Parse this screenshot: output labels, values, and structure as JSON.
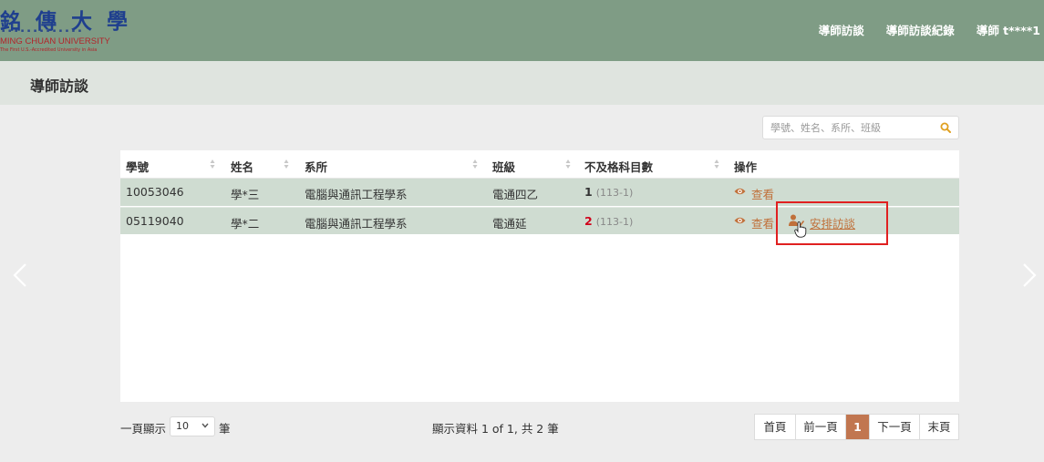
{
  "header": {
    "logo": {
      "name_cn": "銘 傳 大 學",
      "name_en": "MING CHUAN UNIVERSITY",
      "tagline": "The First U.S.-Accredited University in Asia"
    },
    "nav": [
      "導師訪談",
      "導師訪談紀錄",
      "導師 t****1"
    ]
  },
  "page_title": "導師訪談",
  "search": {
    "placeholder": "學號、姓名、系所、班級",
    "value": ""
  },
  "table": {
    "columns": [
      "學號",
      "姓名",
      "系所",
      "班級",
      "不及格科目數",
      "操作"
    ],
    "rows": [
      {
        "student_id": "10053046",
        "name": "學*三",
        "department": "電腦與通訊工程學系",
        "class": "電通四乙",
        "fail_count": "1",
        "term": "(113-1)",
        "actions": [
          "查看"
        ]
      },
      {
        "student_id": "05119040",
        "name": "學*二",
        "department": "電腦與通訊工程學系",
        "class": "電通延",
        "fail_count": "2",
        "term": "(113-1)",
        "actions": [
          "查看",
          "安排訪談"
        ]
      }
    ]
  },
  "footer": {
    "page_size_label": "一頁顯示",
    "page_size_value": "10",
    "page_size_unit": "筆",
    "info": "顯示資料 1 of 1, 共 2 筆",
    "pager": [
      "首頁",
      "前一頁",
      "1",
      "下一頁",
      "末頁"
    ]
  },
  "colors": {
    "header_bg": "#7f9c85",
    "title_bar_bg": "#dfe4df",
    "row_bg": "#cfdcd1",
    "accent": "#c0703a",
    "active_page": "#c17650",
    "fail_red": "#d0021b",
    "highlight_red": "#e02020"
  }
}
